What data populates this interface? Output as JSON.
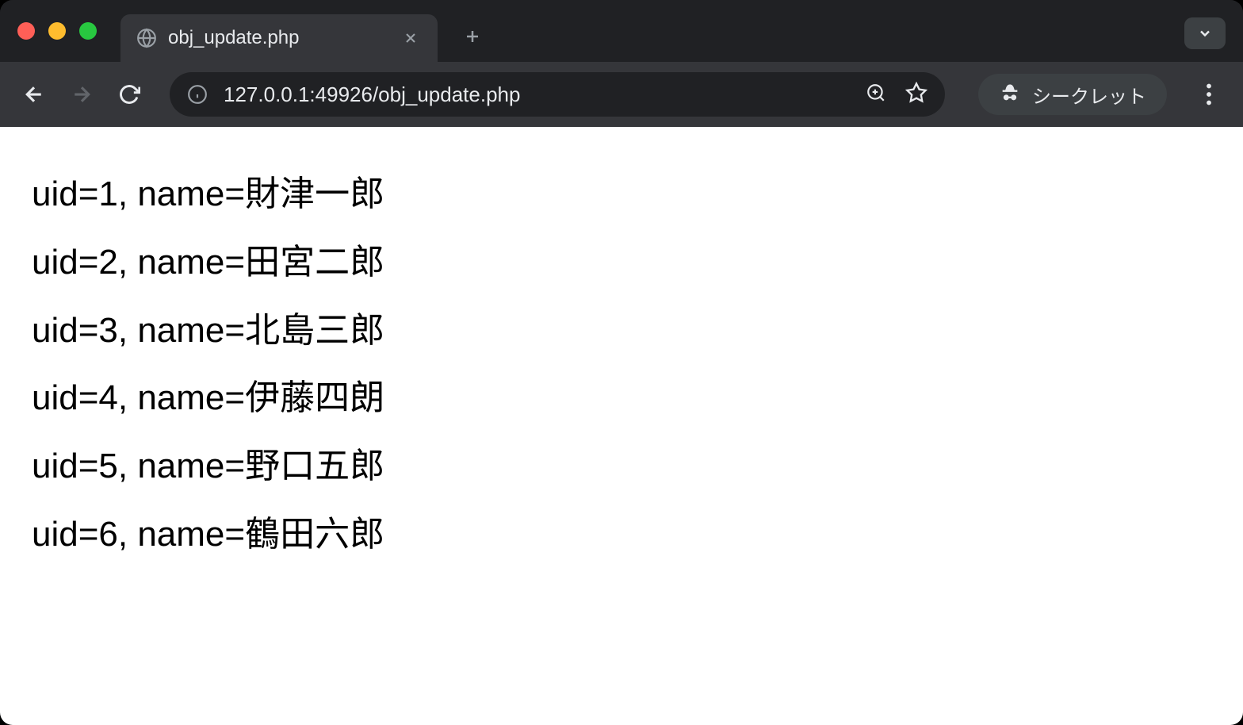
{
  "tab": {
    "title": "obj_update.php"
  },
  "address": {
    "url": "127.0.0.1:49926/obj_update.php"
  },
  "incognito": {
    "label": "シークレット"
  },
  "content": {
    "rows": [
      {
        "uid": "1",
        "name": "財津一郎"
      },
      {
        "uid": "2",
        "name": "田宮二郎"
      },
      {
        "uid": "3",
        "name": "北島三郎"
      },
      {
        "uid": "4",
        "name": "伊藤四朗"
      },
      {
        "uid": "5",
        "name": "野口五郎"
      },
      {
        "uid": "6",
        "name": "鶴田六郎"
      }
    ]
  }
}
